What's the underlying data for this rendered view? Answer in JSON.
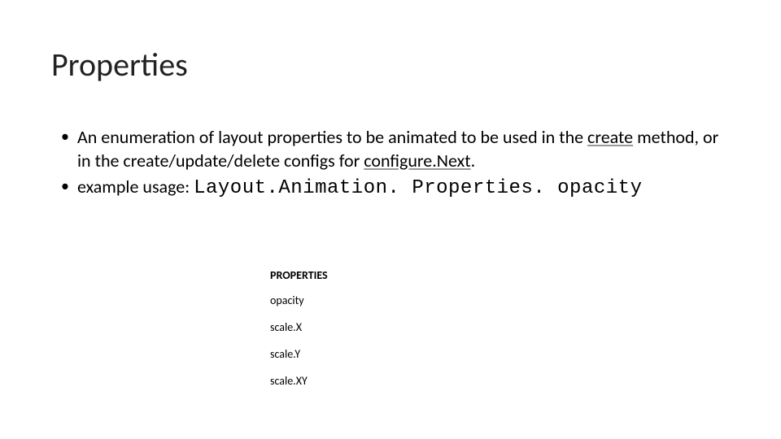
{
  "title": "Properties",
  "bullets": [
    {
      "pre": "An enumeration of layout properties to be animated to be used in the ",
      "link1": "create",
      "mid": " method, or in the create/update/delete configs for ",
      "link2": "configure.Next",
      "post": "."
    },
    {
      "label": "example usage: ",
      "code": "Layout.Animation. Properties. opacity"
    }
  ],
  "table": {
    "header": "PROPERTIES",
    "rows": [
      "opacity",
      "scale.X",
      "scale.Y",
      "scale.XY"
    ]
  }
}
